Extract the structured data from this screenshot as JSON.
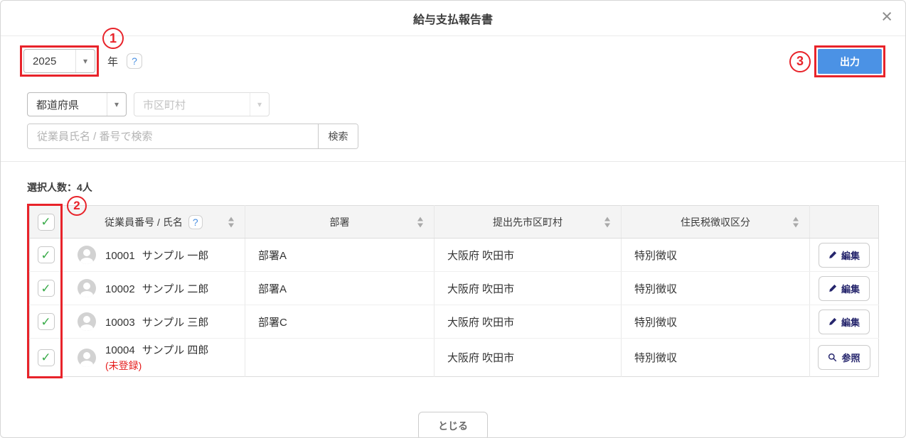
{
  "dialog": {
    "title": "給与支払報告書"
  },
  "icons": {
    "close": "×",
    "caret": "▾",
    "help": "?",
    "check": "✓"
  },
  "toolbar": {
    "year_value": "2025",
    "year_suffix": "年",
    "output_button": "出力"
  },
  "filters": {
    "prefecture_value": "都道府県",
    "city_placeholder": "市区町村",
    "search_placeholder": "従業員氏名 / 番号で検索",
    "search_button": "検索"
  },
  "selection": {
    "count_label": "選択人数：4人"
  },
  "table": {
    "headers": {
      "employee": "従業員番号 / 氏名",
      "department": "部署",
      "city": "提出先市区町村",
      "tax": "住民税徴収区分"
    },
    "rows": [
      {
        "checked": true,
        "employee_no": "10001",
        "name": "サンプル 一郎",
        "note": "",
        "department": "部署A",
        "city": "大阪府 吹田市",
        "tax": "特別徴収",
        "action": "編集",
        "action_type": "edit"
      },
      {
        "checked": true,
        "employee_no": "10002",
        "name": "サンプル 二郎",
        "note": "",
        "department": "部署A",
        "city": "大阪府 吹田市",
        "tax": "特別徴収",
        "action": "編集",
        "action_type": "edit"
      },
      {
        "checked": true,
        "employee_no": "10003",
        "name": "サンプル 三郎",
        "note": "",
        "department": "部署C",
        "city": "大阪府 吹田市",
        "tax": "特別徴収",
        "action": "編集",
        "action_type": "edit"
      },
      {
        "checked": true,
        "employee_no": "10004",
        "name": "サンプル 四郎",
        "note": "(未登録)",
        "department": "",
        "city": "大阪府 吹田市",
        "tax": "特別徴収",
        "action": "参照",
        "action_type": "view"
      }
    ]
  },
  "footer": {
    "close_button": "とじる"
  },
  "annotations": {
    "step1": "1",
    "step2": "2",
    "step3": "3"
  },
  "colors": {
    "primary_blue": "#4b92e5",
    "annotation_red": "#e8232a",
    "check_green": "#3aab4a",
    "action_navy": "#26266d",
    "unregistered_red": "#e51c1c"
  }
}
